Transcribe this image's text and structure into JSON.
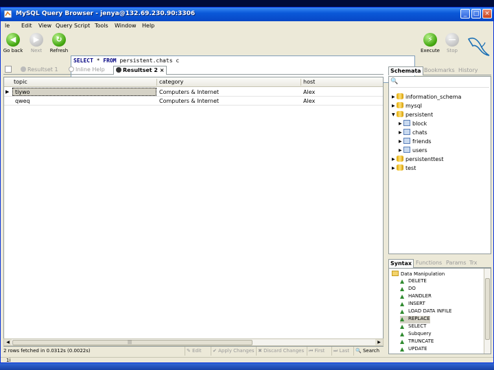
{
  "window": {
    "title": "MySQL Query Browser - jenya@132.69.230.90:3306",
    "min": "_",
    "max": "□",
    "close": "×"
  },
  "menu": [
    "le",
    "Edit",
    "View",
    "Query",
    "Script",
    "Tools",
    "Window",
    "Help"
  ],
  "toolbar": {
    "back": "Go back",
    "next": "Next",
    "refresh": "Refresh",
    "execute": "Execute",
    "stop": "Stop"
  },
  "query": {
    "kw1": "SELECT",
    "mid": " * ",
    "kw2": "FROM",
    "rest": " persistent.chats c"
  },
  "tabs": {
    "t1": "Resultset 1",
    "t2": "Inline Help",
    "t3": "Resultset 2",
    "t3close": "×"
  },
  "grid": {
    "columns": [
      "topic",
      "category",
      "host"
    ],
    "rows": [
      [
        "tiywo",
        "Computers & Internet",
        "Alex"
      ],
      [
        "qweq",
        "Computers & Internet",
        "Alex"
      ]
    ],
    "pointer": "▶"
  },
  "status": {
    "message": "2 rows fetched in 0.0312s (0.0022s)",
    "edit": "Edit",
    "apply": "Apply Changes",
    "discard": "Discard Changes",
    "first": "First",
    "last": "Last",
    "search": "Search"
  },
  "right": {
    "tabs": [
      "Schemata",
      "Bookmarks",
      "History"
    ],
    "schemata": [
      {
        "label": "information_schema",
        "kind": "db",
        "open": false
      },
      {
        "label": "mysql",
        "kind": "db",
        "open": false
      },
      {
        "label": "persistent",
        "kind": "db",
        "open": true
      },
      {
        "label": "block",
        "kind": "table"
      },
      {
        "label": "chats",
        "kind": "table"
      },
      {
        "label": "friends",
        "kind": "table"
      },
      {
        "label": "users",
        "kind": "table"
      },
      {
        "label": "persistenttest",
        "kind": "db",
        "open": false
      },
      {
        "label": "test",
        "kind": "db",
        "open": false
      }
    ],
    "tabs2": [
      "Syntax",
      "Functions",
      "Params",
      "Trx"
    ],
    "syntax_root": "Data Manipulation",
    "syntax": [
      "DELETE",
      "DO",
      "HANDLER",
      "INSERT",
      "LOAD DATA INFILE",
      "REPLACE",
      "SELECT",
      "Subquery",
      "TRUNCATE",
      "UPDATE"
    ]
  },
  "bottom": {
    "label": "1i"
  },
  "colors": {
    "title_bar": "#0a58d8",
    "accent_green": "#45a812",
    "selection": "#d5d2c6"
  }
}
